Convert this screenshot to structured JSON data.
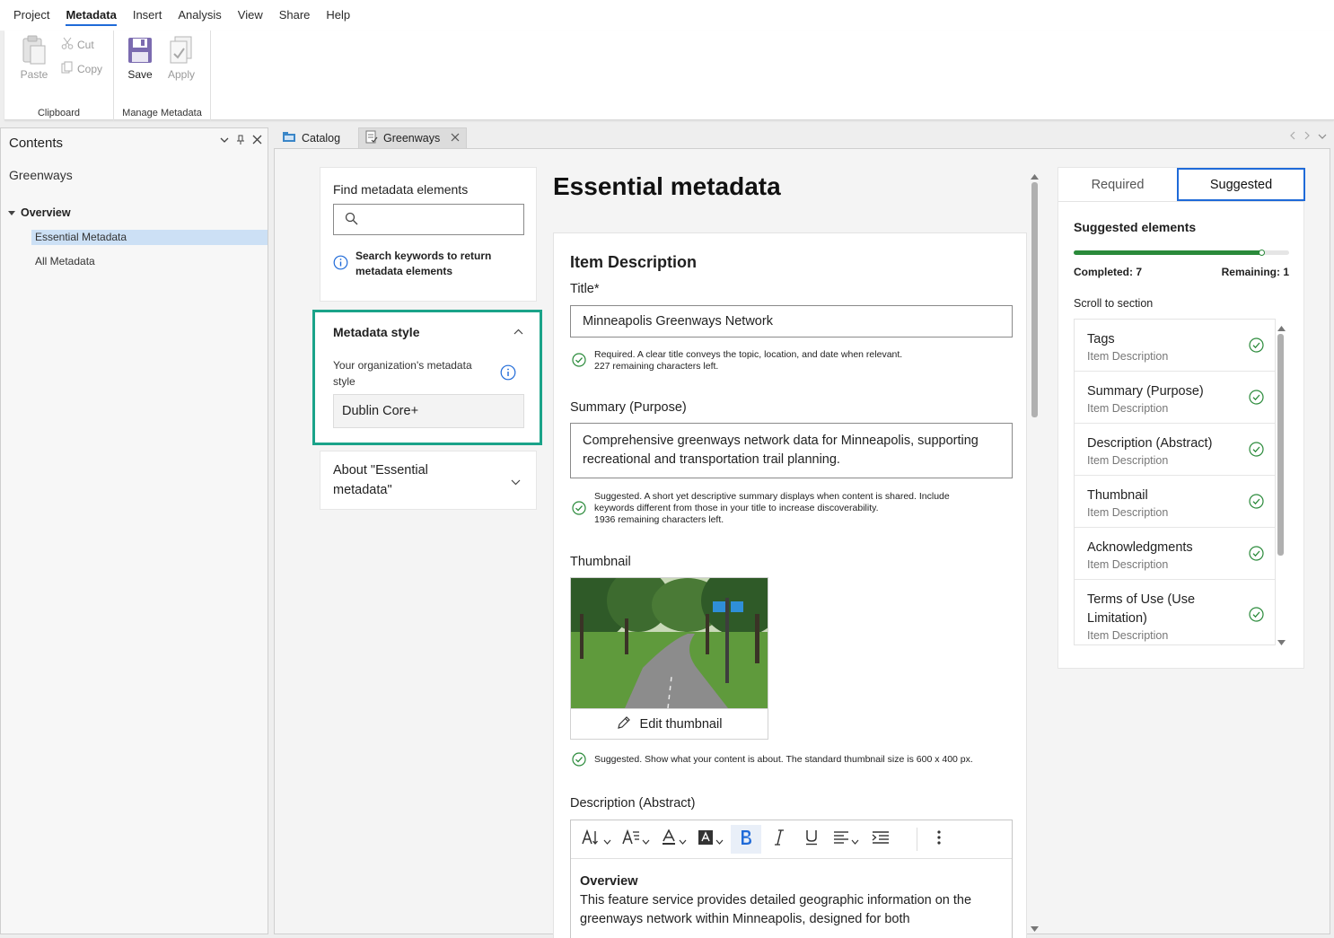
{
  "menu": [
    "Project",
    "Metadata",
    "Insert",
    "Analysis",
    "View",
    "Share",
    "Help"
  ],
  "menu_active": "Metadata",
  "ribbon": {
    "paste": "Paste",
    "cut": "Cut",
    "copy": "Copy",
    "clipboard_group": "Clipboard",
    "save": "Save",
    "apply": "Apply",
    "manage_group": "Manage Metadata"
  },
  "contents": {
    "title": "Contents",
    "map_name": "Greenways",
    "overview": "Overview",
    "items": [
      "Essential Metadata",
      "All Metadata"
    ],
    "selected": "Essential Metadata"
  },
  "tabs": [
    {
      "label": "Catalog",
      "active": false
    },
    {
      "label": "Greenways",
      "active": true
    }
  ],
  "find": {
    "label": "Find metadata elements",
    "placeholder": "",
    "info": "Search keywords to return metadata elements"
  },
  "style": {
    "title": "Metadata style",
    "desc": "Your organization's metadata style",
    "value": "Dublin Core+"
  },
  "about": {
    "label": "About \"Essential metadata\""
  },
  "page_title": "Essential metadata",
  "item_description": {
    "section_title": "Item Description",
    "title_label": "Title*",
    "title_value": "Minneapolis Greenways Network",
    "title_hint_1": "Required. A clear title conveys the topic, location, and date when relevant.",
    "title_hint_2": "227 remaining characters left.",
    "summary_label": "Summary (Purpose)",
    "summary_value": "Comprehensive greenways network data for Minneapolis, supporting recreational and transportation trail planning.",
    "summary_hint_1": "Suggested. A short yet descriptive summary displays when content is shared. Include keywords different from those in your title to increase discoverability.",
    "summary_hint_2": "1936 remaining characters left.",
    "thumbnail_label": "Thumbnail",
    "edit_thumbnail": "Edit thumbnail",
    "thumbnail_hint": "Suggested. Show what your content is about. The standard thumbnail size is 600 x 400 px.",
    "description_label": "Description (Abstract)",
    "description_heading": "Overview",
    "description_text": "This feature service provides detailed geographic information on the greenways network within Minneapolis, designed for both"
  },
  "right_panel": {
    "tab_required": "Required",
    "tab_suggested": "Suggested",
    "active_tab": "Suggested",
    "title": "Suggested elements",
    "progress_fraction": 0.875,
    "completed": "Completed: 7",
    "remaining": "Remaining: 1",
    "scroll_label": "Scroll to section",
    "sections": [
      {
        "name": "Tags",
        "sub": "Item Description",
        "done": true
      },
      {
        "name": "Summary (Purpose)",
        "sub": "Item Description",
        "done": true
      },
      {
        "name": "Description (Abstract)",
        "sub": "Item Description",
        "done": true
      },
      {
        "name": "Thumbnail",
        "sub": "Item Description",
        "done": true
      },
      {
        "name": "Acknowledgments",
        "sub": "Item Description",
        "done": true
      },
      {
        "name": "Terms of Use (Use Limitation)",
        "sub": "Item Description",
        "done": true
      }
    ]
  },
  "colors": {
    "accent": "#1f6ad8",
    "highlight_border": "#1aa389",
    "progress": "#2a8a3a",
    "check": "#2a8a3a"
  }
}
